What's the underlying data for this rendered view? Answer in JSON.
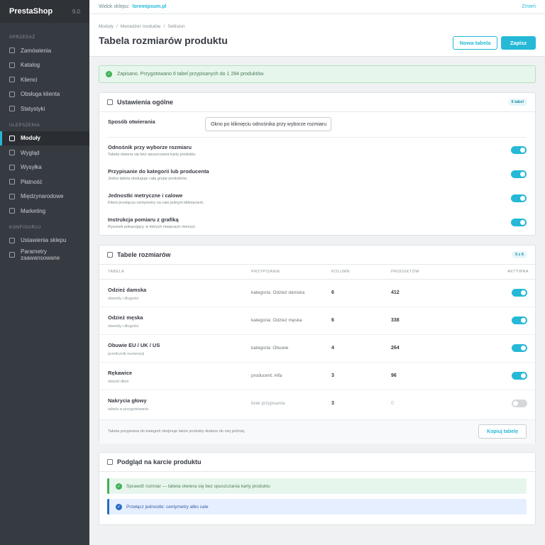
{
  "sidebar": {
    "brand": "PrestaShop",
    "version": "9.0",
    "sections": [
      {
        "title": "SPRZEDAŻ",
        "items": [
          "Zamówienia",
          "Katalog",
          "Klienci",
          "Obsługa klienta",
          "Statystyki"
        ]
      },
      {
        "title": "ULEPSZENIA",
        "items": [
          "Moduły",
          "Wygląd",
          "Wysyłka",
          "Płatność",
          "Międzynarodowe",
          "Marketing"
        ]
      },
      {
        "title": "KONFIGURUJ",
        "items": [
          "Ustawienia sklepu",
          "Parametry zaawansowane"
        ]
      }
    ],
    "active_item": "Moduły"
  },
  "topbar": {
    "shop_view_label": "Widok sklepu:",
    "shop_domain": "loremipsum.pl",
    "change_link": "Zmień"
  },
  "header": {
    "breadcrumb": [
      "Moduły",
      "Menedżer modułów",
      "Sellision"
    ],
    "title": "Tabela rozmiarów produktu",
    "new_table_button": "Nowa tabela",
    "save_button": "Zapisz"
  },
  "alert": {
    "text": "Zapisano. Przygotowano 6 tabel przypisanych do 1 284 produktów."
  },
  "general_settings": {
    "title": "Ustawienia ogólne",
    "badge": "6 tabel",
    "opening_label": "Sposób otwierania",
    "opening_value": "Okno po kliknięciu odnośnika przy wyborze rozmiaru",
    "options": [
      {
        "title": "Odnośnik przy wyborze rozmiaru",
        "desc": "Tabela otwiera się bez opuszczania karty produktu.",
        "enabled": true
      },
      {
        "title": "Przypisanie do kategorii lub producenta",
        "desc": "Jedna tabela obsługuje całą grupę produktów.",
        "enabled": true
      },
      {
        "title": "Jednostki metryczne i calowe",
        "desc": "Klient przełącza centymetry na cale jednym kliknięciem.",
        "enabled": true
      },
      {
        "title": "Instrukcja pomiaru z grafiką",
        "desc": "Rysunek pokazujący, w których miejscach mierzyć.",
        "enabled": true
      }
    ]
  },
  "size_tables": {
    "title": "Tabele rozmiarów",
    "badge": "5 z 6",
    "columns": [
      "TABELA",
      "PRZYPISANIE",
      "KOLUMN",
      "PRODUKTÓW",
      "AKTYWNA"
    ],
    "rows": [
      {
        "name": "Odzież damska",
        "sub": "obwody i długości",
        "assign": "kategoria: Odzież damska",
        "cols": "6",
        "products": "412",
        "active": true
      },
      {
        "name": "Odzież męska",
        "sub": "obwody i długości",
        "assign": "kategoria: Odzież męska",
        "cols": "6",
        "products": "338",
        "active": true
      },
      {
        "name": "Obuwie EU / UK / US",
        "sub": "przelicznik numeracji",
        "assign": "kategoria: Obuwie",
        "cols": "4",
        "products": "264",
        "active": true
      },
      {
        "name": "Rękawice",
        "sub": "obwód dłoni",
        "assign": "producent: Alfa",
        "cols": "3",
        "products": "96",
        "active": true
      },
      {
        "name": "Nakrycia głowy",
        "sub": "tabela w przygotowaniu",
        "assign": "brak przypisania",
        "cols": "3",
        "products": "0",
        "active": false
      }
    ],
    "footer_note": "Tabela przypisana do kategorii obejmuje także produkty dodane do niej później.",
    "copy_button": "Kopiuj tabelę"
  },
  "preview": {
    "title": "Podgląd na karcie produktu",
    "success_text": "Sprawdź rozmiar — tabela otwiera się bez opuszczania karty produktu",
    "info_text": "Przełącz jednostki: centymetry albo cale"
  },
  "colors": {
    "accent": "#25b9d7",
    "sidebar": "#363a41",
    "success": "#3fb257",
    "info": "#2a6dc6"
  }
}
